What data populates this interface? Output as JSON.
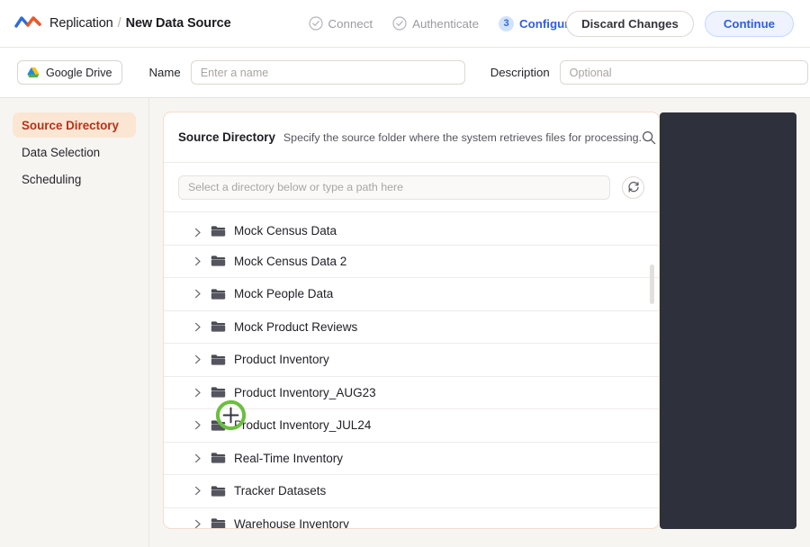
{
  "header": {
    "logo_icon": "replication-wave-logo",
    "breadcrumb_root": "Replication",
    "breadcrumb_sep": "/",
    "breadcrumb_current": "New Data Source",
    "steps": [
      {
        "label": "Connect",
        "state": "done",
        "icon": "check-circle-icon"
      },
      {
        "label": "Authenticate",
        "state": "done",
        "icon": "check-circle-icon"
      },
      {
        "label": "Configure",
        "state": "active",
        "number": "3"
      }
    ],
    "help_icon": "question-circle-icon",
    "discard_label": "Discard Changes",
    "continue_label": "Continue",
    "accent_blue": "#2f5fe0",
    "accent_orange": "#f2561f"
  },
  "subbar": {
    "source_chip_label": "Google Drive",
    "source_chip_icon": "google-drive-icon",
    "name_label": "Name",
    "name_value": "",
    "name_placeholder": "Enter a name",
    "description_label": "Description",
    "description_value": "",
    "description_placeholder": "Optional"
  },
  "sidebar": {
    "items": [
      {
        "label": "Source Directory",
        "active": true
      },
      {
        "label": "Data Selection",
        "active": false
      },
      {
        "label": "Scheduling",
        "active": false
      }
    ],
    "active_bg": "#fbe6d4",
    "active_fg": "#b3331a"
  },
  "panel": {
    "title": "Source Directory",
    "subtitle": "Specify the source folder where the system retrieves files for processing.",
    "search_icon": "search-icon",
    "path_value": "",
    "path_placeholder": "Select a directory below or type a path here",
    "refresh_icon": "refresh-icon",
    "chevron_icon": "chevron-right-icon",
    "folder_icon": "folder-icon",
    "tree_rows": [
      {
        "label": "Mock Census Data"
      },
      {
        "label": "Mock Census Data 2"
      },
      {
        "label": "Mock People Data"
      },
      {
        "label": "Mock Product Reviews"
      },
      {
        "label": "Product Inventory"
      },
      {
        "label": "Product Inventory_AUG23"
      },
      {
        "label": "Product Inventory_JUL24"
      },
      {
        "label": "Real-Time Inventory"
      },
      {
        "label": "Tracker Datasets"
      },
      {
        "label": "Warehouse Inventory"
      }
    ]
  },
  "cursor": {
    "icon": "crosshair-cursor",
    "ring_color": "#6bbf3f"
  },
  "dark_panel": {
    "color": "#2e303b"
  }
}
